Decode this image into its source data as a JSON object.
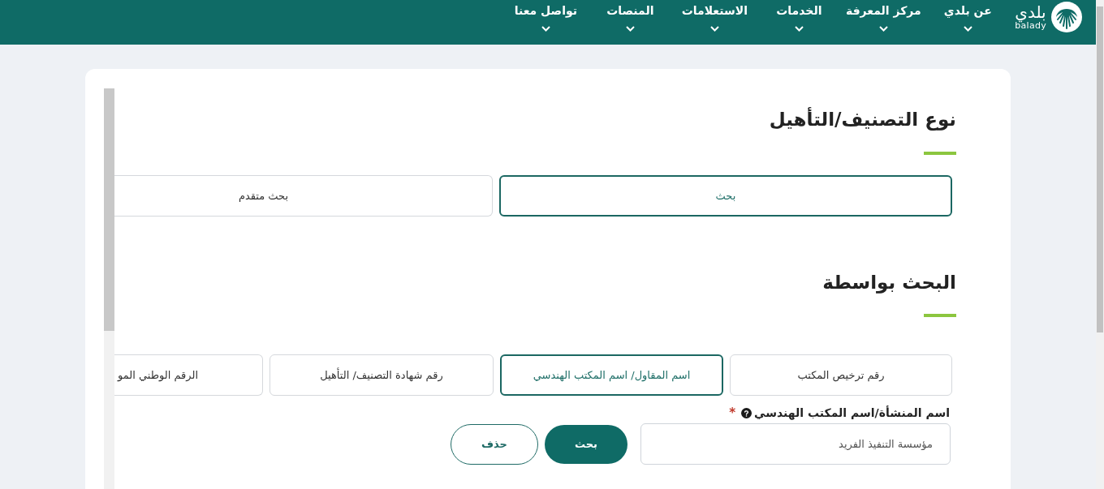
{
  "header": {
    "logo": {
      "arabic": "بلدي",
      "latin": "balady"
    },
    "nav_items": [
      {
        "label": "عن بلدي"
      },
      {
        "label": "مركز المعرفة"
      },
      {
        "label": "الخدمات"
      },
      {
        "label": "الاستعلامات"
      },
      {
        "label": "المنصات"
      },
      {
        "label": "تواصل معنا"
      }
    ]
  },
  "sections": [
    {
      "title": "نوع التصنيف/التأهيل",
      "options": [
        {
          "label": "بحث",
          "selected": true
        },
        {
          "label": "بحث متقدم",
          "selected": false
        }
      ]
    },
    {
      "title": "البحث بواسطة",
      "options": [
        {
          "label": "رقم ترخيص المكتب",
          "selected": false
        },
        {
          "label": "اسم المقاول/ اسم المكتب الهندسي",
          "selected": true
        },
        {
          "label": "رقم شهادة التصنيف/ التأهيل",
          "selected": false
        },
        {
          "label": "الرقم الوطني المو",
          "selected": false
        }
      ]
    }
  ],
  "form": {
    "field": {
      "label": "اسم المنشأة/اسم المكتب الهندسي",
      "required_mark": "*",
      "value": "مؤسسة التنفيذ الفريد"
    },
    "buttons": [
      {
        "label": "بحث",
        "kind": "primary"
      },
      {
        "label": "حذف",
        "kind": "secondary"
      }
    ]
  }
}
